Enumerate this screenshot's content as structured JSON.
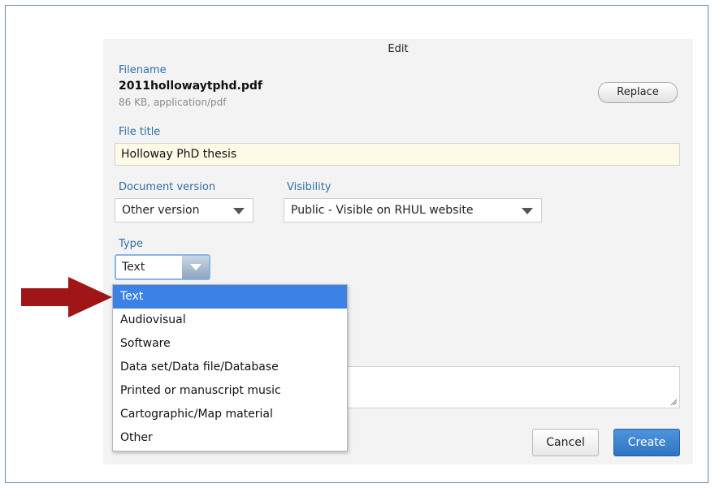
{
  "dialog": {
    "title": "Edit",
    "filename_label": "Filename",
    "filename": "2011hollowaytphd.pdf",
    "file_meta": "86 KB, application/pdf",
    "replace_label": "Replace",
    "file_title_label": "File title",
    "file_title_value": "Holloway PhD thesis",
    "doc_version_label": "Document version",
    "doc_version_value": "Other version",
    "visibility_label": "Visibility",
    "visibility_value": "Public - Visible on RHUL website",
    "type_label": "Type",
    "type_value": "Text",
    "cancel_label": "Cancel",
    "create_label": "Create"
  },
  "type_dropdown": {
    "options": [
      "Text",
      "Audiovisual",
      "Software",
      "Data set/Data file/Database",
      "Printed or manuscript music",
      "Cartographic/Map material",
      "Other"
    ],
    "selected_index": 0
  },
  "icons": {
    "annotation_arrow": "right-arrow-icon",
    "select_caret": "chevron-down-icon",
    "resize_grip": "resize-grip-icon"
  },
  "colors": {
    "arrow": "#a01616",
    "selected_option": "#3b82e4",
    "primary_button": "#2f74c0",
    "label_blue": "#2f6fa8",
    "title_input_bg": "#fdfbe6"
  }
}
